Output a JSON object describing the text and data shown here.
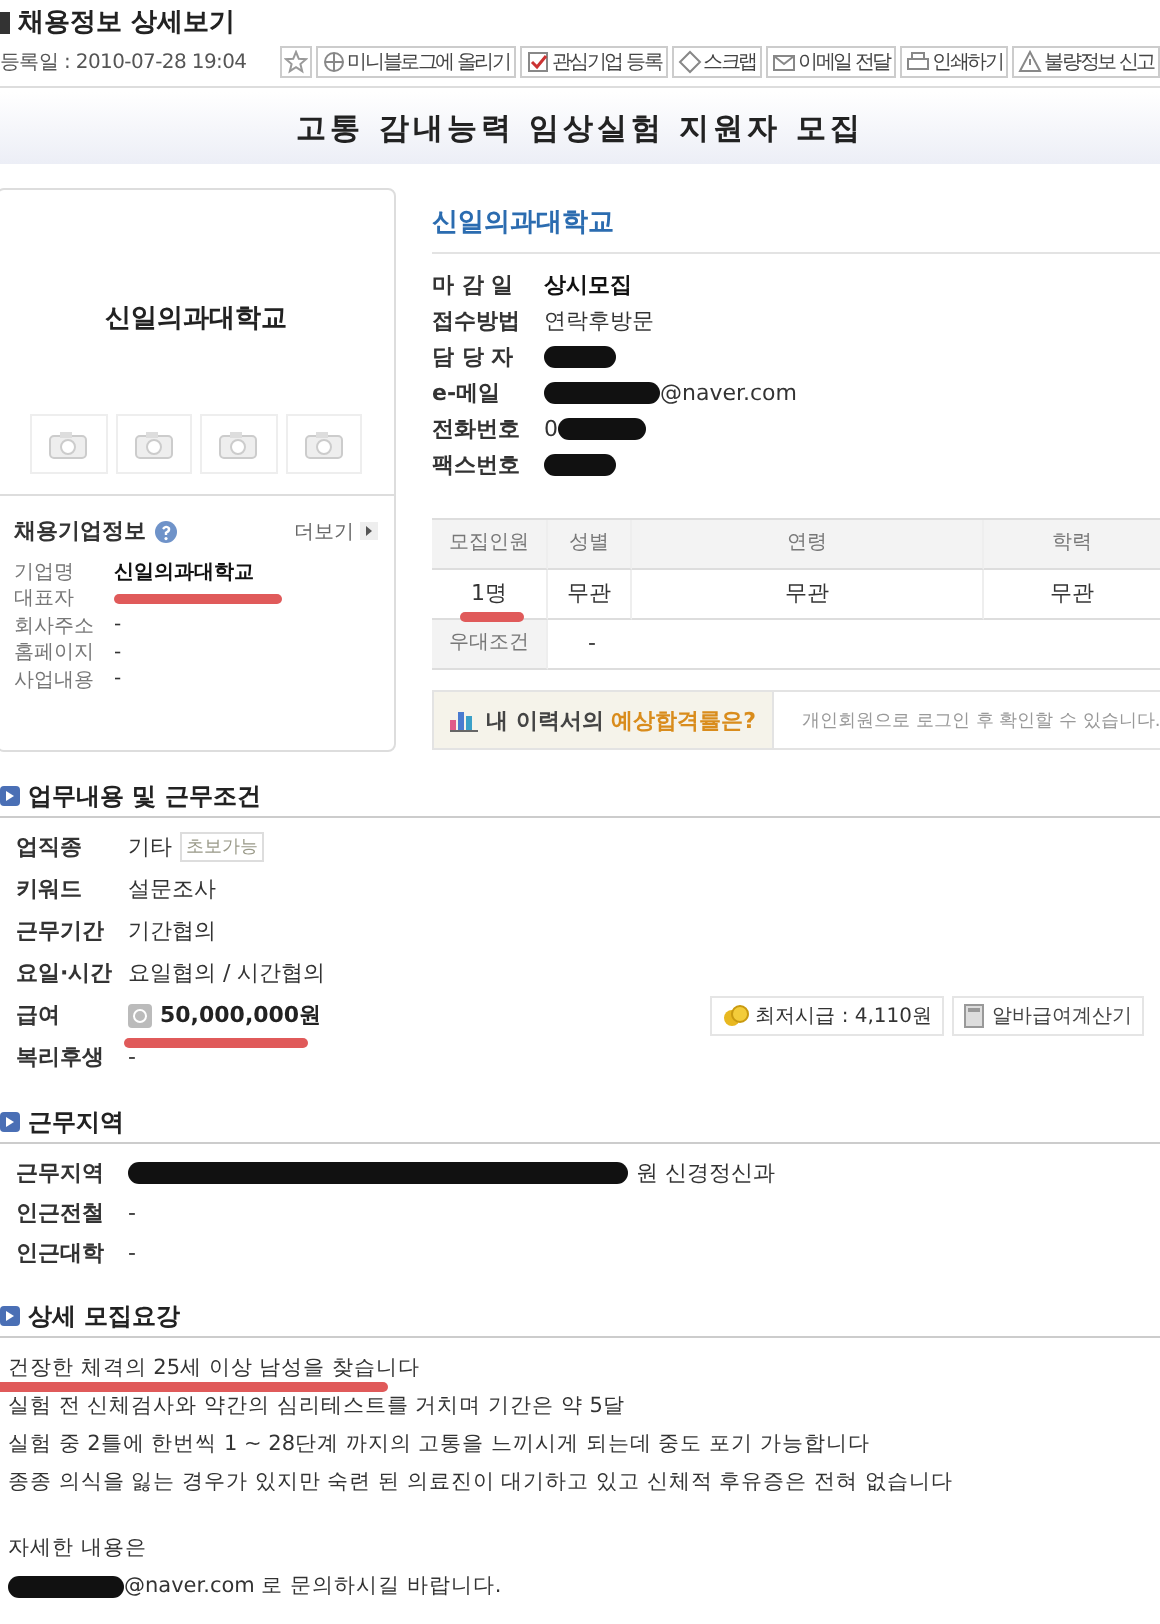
{
  "page_header": {
    "title": "채용정보 상세보기",
    "posted": "등록일 : 2010-07-28 19:04"
  },
  "toolbar": [
    {
      "kind": "star"
    },
    {
      "kind": "blog",
      "label": "미니블로그에 올리기"
    },
    {
      "kind": "check",
      "label": "관심기업 등록"
    },
    {
      "kind": "scrap",
      "label": "스크랩"
    },
    {
      "kind": "mail",
      "label": "이메일 전달"
    },
    {
      "kind": "print",
      "label": "인쇄하기"
    },
    {
      "kind": "warn",
      "label": "불량정보 신고"
    }
  ],
  "job_title": "고통 감내능력 임상실험 지원자 모집",
  "company_card": {
    "logo_text": "신일의과대학교",
    "info_title": "채용기업정보",
    "more": "더보기",
    "rows": [
      {
        "label": "기업명",
        "value": "신일의과대학교",
        "bold": true
      },
      {
        "label": "대표자",
        "underlined": true
      },
      {
        "label": "회사주소",
        "value": "-"
      },
      {
        "label": "홈페이지",
        "value": "-"
      },
      {
        "label": "사업내용",
        "value": "-"
      }
    ]
  },
  "recruiter": {
    "name": "신일의과대학교",
    "rows": [
      {
        "label": "마 감 일",
        "value": "상시모집",
        "bold": true
      },
      {
        "label": "접수방법",
        "value": "연락후방문"
      },
      {
        "label": "담 당 자",
        "redacted": true
      },
      {
        "label": "e-메일",
        "value": "@naver.com",
        "redacted": true
      },
      {
        "label": "전화번호",
        "value": "0",
        "redacted": true,
        "redaction_after": true
      },
      {
        "label": "팩스번호",
        "redacted": true
      }
    ]
  },
  "requirements": {
    "columns": [
      "모집인원",
      "성별",
      "연령",
      "학력"
    ],
    "cells": [
      {
        "text": "1명",
        "underlined": true
      },
      {
        "text": "무관",
        "underlined": false
      },
      {
        "text": "무관",
        "underlined": false
      },
      {
        "text": "무관",
        "underlined": false
      }
    ],
    "preference": {
      "label": "우대조건",
      "value": "-"
    }
  },
  "banner": {
    "title": "내 이력서의",
    "highlight": "예상합격률은?",
    "note": "개인회원으로 로그인 후 확인할 수 있습니다."
  },
  "work_conditions": {
    "heading": "업무내용 및 근무조건",
    "rows": [
      {
        "label": "업직종",
        "value": "기타",
        "tag": "초보가능"
      },
      {
        "label": "키워드",
        "value": "설문조사"
      },
      {
        "label": "근무기간",
        "value": "기간협의"
      },
      {
        "label": "요일·시간",
        "value": "요일협의 / 시간협의"
      },
      {
        "label": "급여",
        "value": "50,000,000원",
        "kind": "pay",
        "underlined": true
      },
      {
        "label": "복리후생",
        "value": "-"
      }
    ],
    "min_wage": "최저시급 : 4,110원",
    "calculator": "알바급여계산기"
  },
  "location": {
    "heading": "근무지역",
    "rows": [
      {
        "label": "근무지역",
        "value": "원 신경정신과",
        "redacted": true
      },
      {
        "label": "인근전철",
        "value": "-"
      },
      {
        "label": "인근대학",
        "value": "-"
      }
    ]
  },
  "details": {
    "heading": "상세 모집요강",
    "lines": [
      {
        "text": "건장한 체격의 25세 이상 남성을 찾습니다",
        "underlined": true
      },
      {
        "text": "실험 전 신체검사와 약간의 심리테스트를 거치며 기간은 약 5달"
      },
      {
        "text": "실험 중 2틀에 한번씩 1 ~ 28단계 까지의 고통을 느끼시게 되는데 중도 포기 가능합니다"
      },
      {
        "text": "종종 의식을 잃는 경우가 있지만 숙련 된 의료진이 대기하고 있고 신체적 후유증은 전혀 없습니다"
      },
      {
        "text": "자세한 내용은",
        "new_paragraph": true
      },
      {
        "text": "@naver.com 로 문의하시길 바랍니다.",
        "redacted": true
      }
    ]
  }
}
